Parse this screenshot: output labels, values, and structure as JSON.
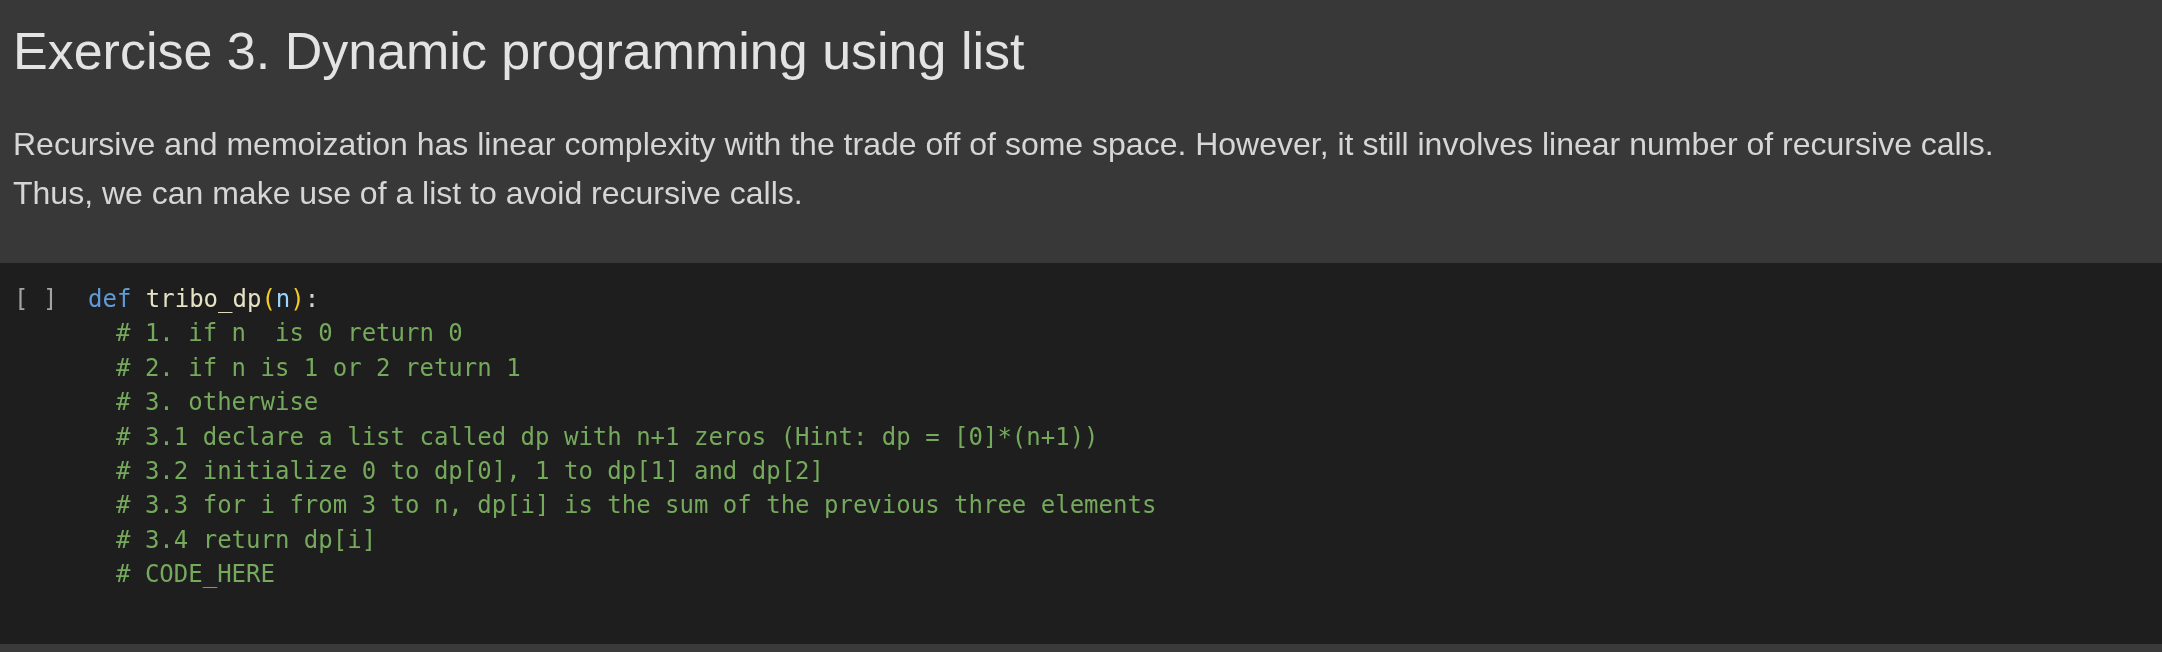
{
  "text_cell": {
    "heading": "Exercise 3. Dynamic programming using list",
    "paragraph": "Recursive and memoization has linear complexity with the trade off of some space. However, it still involves linear number of recursive calls.\nThus, we can make use of a list to avoid recursive calls."
  },
  "code_cell": {
    "prompt": "[ ]",
    "signature": [
      {
        "text": "def ",
        "kind": "keyword"
      },
      {
        "text": "tribo_dp",
        "kind": "function"
      },
      {
        "text": "(",
        "kind": "bracket"
      },
      {
        "text": "n",
        "kind": "parameter"
      },
      {
        "text": ")",
        "kind": "bracket"
      },
      {
        "text": ":",
        "kind": "punctuation"
      }
    ],
    "body": [
      {
        "text": "# 1. if n  is 0 return 0",
        "kind": "comment"
      },
      {
        "text": "# 2. if n is 1 or 2 return 1",
        "kind": "comment"
      },
      {
        "text": "# 3. otherwise",
        "kind": "comment"
      },
      {
        "text": "# 3.1 declare a list called dp with n+1 zeros (Hint: dp = [0]*(n+1))",
        "kind": "comment"
      },
      {
        "text": "# 3.2 initialize 0 to dp[0], 1 to dp[1] and dp[2]",
        "kind": "comment"
      },
      {
        "text": "# 3.3 for i from 3 to n, dp[i] is the sum of the previous three elements",
        "kind": "comment"
      },
      {
        "text": "# 3.4 return dp[i]",
        "kind": "comment"
      },
      {
        "text": "# CODE_HERE",
        "kind": "comment"
      }
    ]
  }
}
